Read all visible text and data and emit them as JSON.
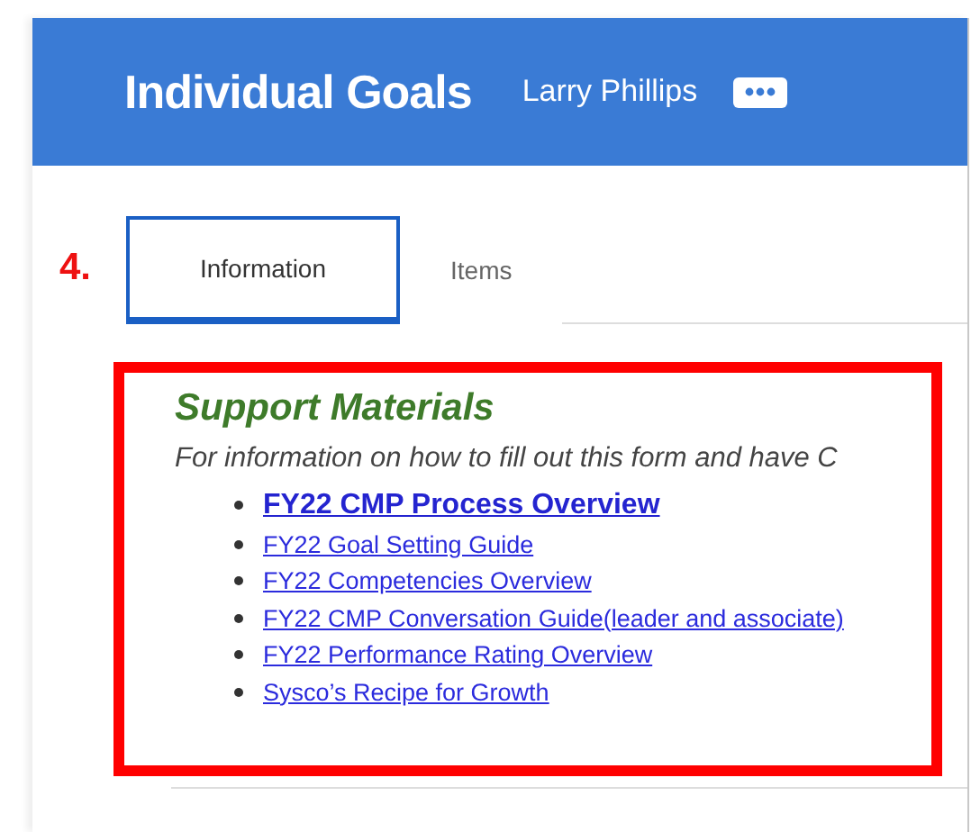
{
  "header": {
    "title": "Individual Goals",
    "user": "Larry Phillips"
  },
  "step_label": "4.",
  "tabs": [
    {
      "label": "Information",
      "selected": true
    },
    {
      "label": "Items",
      "selected": false
    }
  ],
  "support_materials": {
    "heading": "Support Materials",
    "description": "For information on how to fill out this form and have C",
    "links": [
      {
        "label": "FY22 CMP Process Overview",
        "kind": "primary"
      },
      {
        "label": "FY22 Goal Setting Guide",
        "kind": "normal"
      },
      {
        "label": "FY22 Competencies Overview",
        "kind": "normal"
      },
      {
        "label": "FY22 CMP Conversation Guide(leader and associate)",
        "kind": "normal"
      },
      {
        "label": "FY22 Performance Rating Overview",
        "kind": "normal"
      },
      {
        "label": "Sysco’s Recipe for Growth",
        "kind": "normal"
      }
    ]
  }
}
